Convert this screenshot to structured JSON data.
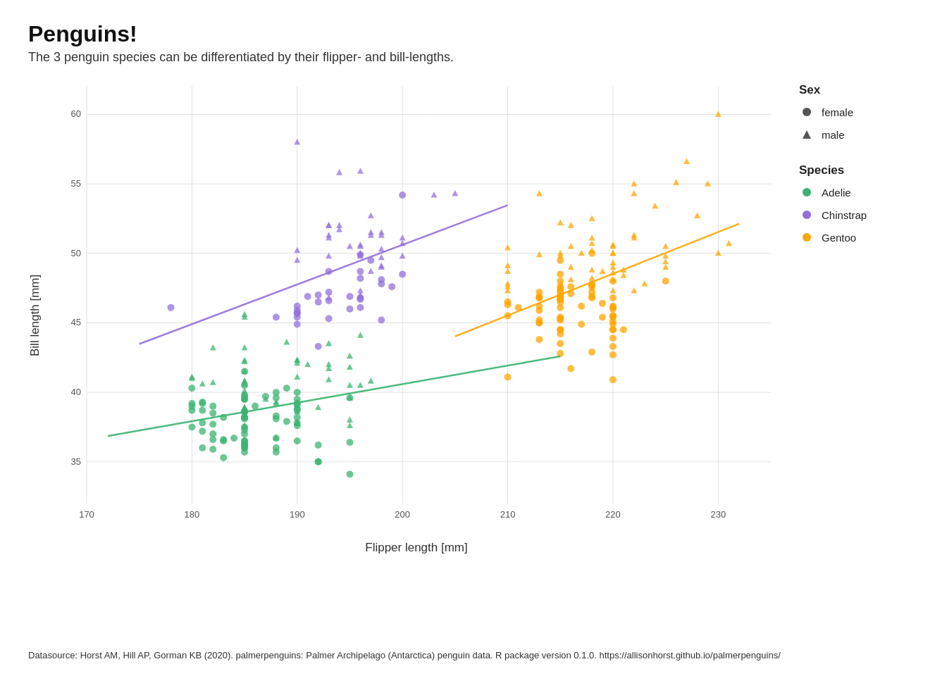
{
  "title": "Penguins!",
  "subtitle": "The 3 penguin species can be differentiated by their flipper- and bill-lengths.",
  "x_label": "Flipper length [mm]",
  "y_label": "Bill length [mm]",
  "datasource": "Datasource:\nHorst AM, Hill AP, Gorman KB (2020). palmerpenguins:\nPalmer Archipelago (Antarctica) penguin data.\nR package version 0.1.0. https://allisonhorst.github.io/palmerpenguins/",
  "legend": {
    "sex_title": "Sex",
    "sex_items": [
      {
        "label": "female",
        "shape": "circle"
      },
      {
        "label": "male",
        "shape": "triangle"
      }
    ],
    "species_title": "Species",
    "species_items": [
      {
        "label": "Adelie",
        "color": "#3CB371"
      },
      {
        "label": "Chinstrap",
        "color": "#9370DB"
      },
      {
        "label": "Gentoo",
        "color": "#FFA500"
      }
    ]
  },
  "colors": {
    "adelie": "#3CB371",
    "chinstrap": "#9370DB",
    "gentoo": "#FFA500",
    "grid": "#dddddd",
    "axis_text": "#555555"
  },
  "x_axis": {
    "min": 170,
    "max": 235,
    "ticks": [
      170,
      180,
      190,
      200,
      210,
      220,
      230
    ]
  },
  "y_axis": {
    "min": 32,
    "max": 62,
    "ticks": [
      35,
      40,
      45,
      50,
      55,
      60
    ]
  }
}
